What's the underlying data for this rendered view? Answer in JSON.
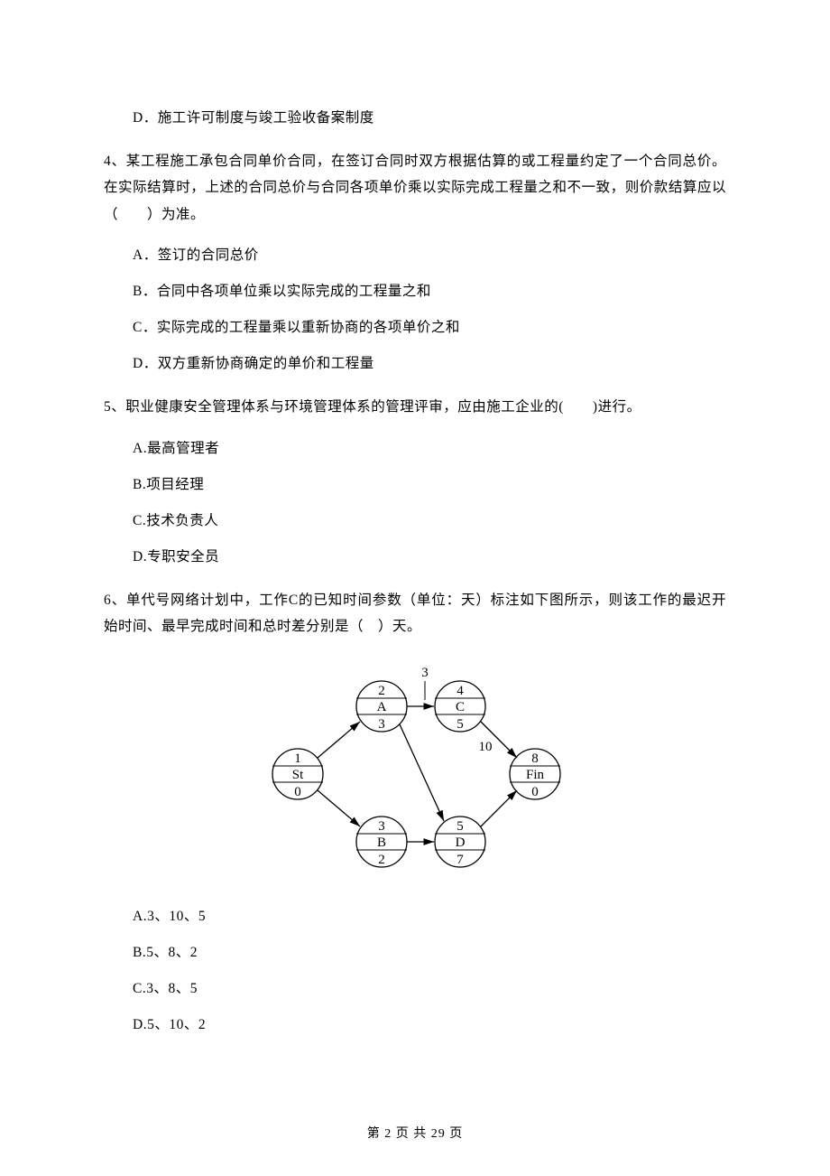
{
  "q3": {
    "opt_d": "D．施工许可制度与竣工验收备案制度"
  },
  "q4": {
    "stem": "4、某工程施工承包合同单价合同，在签订合同时双方根据估算的或工程量约定了一个合同总价。在实际结算时，上述的合同总价与合同各项单价乘以实际完成工程量之和不一致，则价款结算应以（　　）为准。",
    "opt_a": "A．签订的合同总价",
    "opt_b": "B．合同中各项单位乘以实际完成的工程量之和",
    "opt_c": "C．实际完成的工程量乘以重新协商的各项单价之和",
    "opt_d": "D．双方重新协商确定的单价和工程量"
  },
  "q5": {
    "stem": "5、职业健康安全管理体系与环境管理体系的管理评审，应由施工企业的(　　)进行。",
    "opt_a": "A.最高管理者",
    "opt_b": "B.项目经理",
    "opt_c": "C.技术负责人",
    "opt_d": "D.专职安全员"
  },
  "q6": {
    "stem": "6、单代号网络计划中，工作C的已知时间参数（单位：天）标注如下图所示，则该工作的最迟开始时间、最早完成时间和总时差分别是（　）天。",
    "opt_a": "A.3、10、5",
    "opt_b": "B.5、8、2",
    "opt_c": "C.3、8、5",
    "opt_d": "D.5、10、2"
  },
  "diagram": {
    "three_label": "3",
    "ten_label": "10",
    "node_st": {
      "top": "1",
      "mid": "St",
      "bot": "0"
    },
    "node_a": {
      "top": "2",
      "mid": "A",
      "bot": "3"
    },
    "node_b": {
      "top": "3",
      "mid": "B",
      "bot": "2"
    },
    "node_c": {
      "top": "4",
      "mid": "C",
      "bot": "5"
    },
    "node_d": {
      "top": "5",
      "mid": "D",
      "bot": "7"
    },
    "node_fin": {
      "top": "8",
      "mid": "Fin",
      "bot": "0"
    }
  },
  "footer": "第 2 页 共 29 页"
}
